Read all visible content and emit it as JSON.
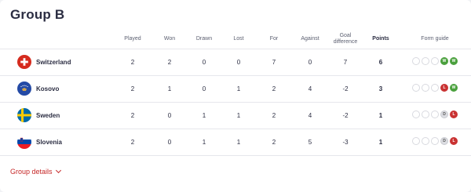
{
  "group": {
    "title": "Group B",
    "details_label": "Group details"
  },
  "columns": {
    "played": "Played",
    "won": "Won",
    "drawn": "Drawn",
    "lost": "Lost",
    "for": "For",
    "against": "Against",
    "goal_diff_line1": "Goal",
    "goal_diff_line2": "difference",
    "points": "Points",
    "form": "Form guide"
  },
  "teams": [
    {
      "name": "Switzerland",
      "flag": "switzerland-flag-icon",
      "played": "2",
      "won": "2",
      "drawn": "0",
      "lost": "0",
      "for": "7",
      "against": "0",
      "diff": "7",
      "points": "6",
      "form": [
        "",
        "",
        "",
        "W",
        "W"
      ]
    },
    {
      "name": "Kosovo",
      "flag": "kosovo-flag-icon",
      "played": "2",
      "won": "1",
      "drawn": "0",
      "lost": "1",
      "for": "2",
      "against": "4",
      "diff": "-2",
      "points": "3",
      "form": [
        "",
        "",
        "",
        "L",
        "W"
      ]
    },
    {
      "name": "Sweden",
      "flag": "sweden-flag-icon",
      "played": "2",
      "won": "0",
      "drawn": "1",
      "lost": "1",
      "for": "2",
      "against": "4",
      "diff": "-2",
      "points": "1",
      "form": [
        "",
        "",
        "",
        "D",
        "L"
      ]
    },
    {
      "name": "Slovenia",
      "flag": "slovenia-flag-icon",
      "played": "2",
      "won": "0",
      "drawn": "1",
      "lost": "1",
      "for": "2",
      "against": "5",
      "diff": "-3",
      "points": "1",
      "form": [
        "",
        "",
        "",
        "D",
        "L"
      ]
    }
  ],
  "colors": {
    "win": "#4aa03d",
    "loss": "#c93232",
    "draw": "#dcdde2",
    "accent": "#c62828"
  }
}
